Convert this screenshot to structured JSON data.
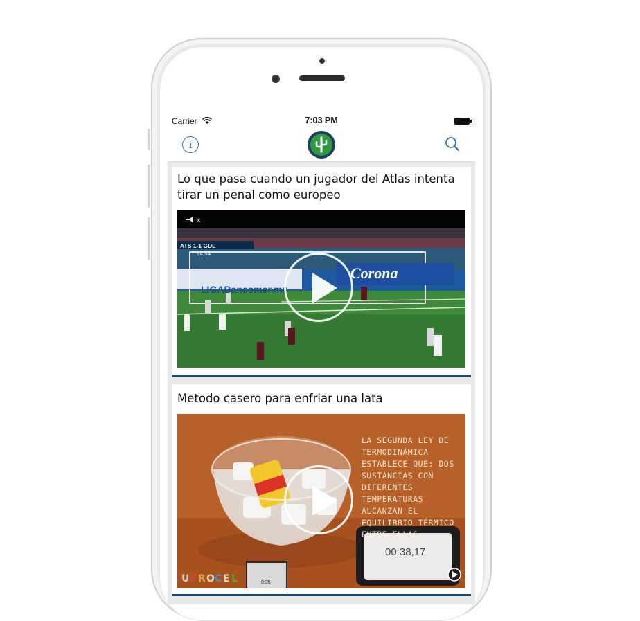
{
  "status_bar": {
    "carrier": "Carrier",
    "time": "7:03 PM"
  },
  "nav": {
    "info_icon": "info-icon",
    "logo_icon": "cactus-icon",
    "search_icon": "search-icon",
    "accent_color": "#2f6fa3",
    "logo_ring_color": "#1f3d5a",
    "logo_fill_color": "#2e9b3f"
  },
  "feed": {
    "items": [
      {
        "title": "Lo que pasa cuando un jugador del Atlas intenta tirar un penal como europeo",
        "thumb_texts": [
          "ATS 1-1 GDL",
          "94:54",
          "LIGABancomer.mx",
          "Corona"
        ]
      },
      {
        "title": "Metodo casero para enfriar una lata",
        "thumb_text": "La segunda ley de termodinámica establece que: dos sustancias con diferentes temperaturas alcanzan el equilibrio térmico entre ellas",
        "timer": "00:38,17",
        "thumb_time": "0:35"
      }
    ]
  }
}
